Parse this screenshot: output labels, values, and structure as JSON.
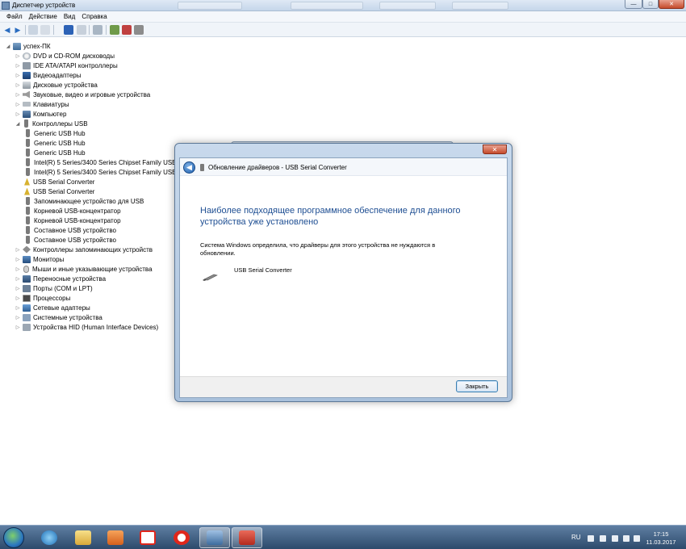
{
  "window": {
    "title": "Диспетчер устройств",
    "min_glyph": "—",
    "max_glyph": "□",
    "close_glyph": "✕"
  },
  "menu": [
    "Файл",
    "Действие",
    "Вид",
    "Справка"
  ],
  "tree": {
    "root": "успех-ПК",
    "items": [
      {
        "label": "DVD и CD-ROM дисководы",
        "icon": "ic-disc",
        "expander": "▷"
      },
      {
        "label": "IDE ATA/ATAPI контроллеры",
        "icon": "ic-ide",
        "expander": "▷"
      },
      {
        "label": "Видеоадаптеры",
        "icon": "ic-video",
        "expander": "▷"
      },
      {
        "label": "Дисковые устройства",
        "icon": "ic-disk",
        "expander": "▷"
      },
      {
        "label": "Звуковые, видео и игровые устройства",
        "icon": "ic-sound",
        "expander": "▷"
      },
      {
        "label": "Клавиатуры",
        "icon": "ic-kbd",
        "expander": "▷"
      },
      {
        "label": "Компьютер",
        "icon": "ic-pc",
        "expander": "▷"
      },
      {
        "label": "Контроллеры USB",
        "icon": "ic-usb",
        "expander": "◢"
      }
    ],
    "usb_children": [
      {
        "label": "Generic USB Hub",
        "icon": "ic-usb"
      },
      {
        "label": "Generic USB Hub",
        "icon": "ic-usb"
      },
      {
        "label": "Generic USB Hub",
        "icon": "ic-usb"
      },
      {
        "label": "Intel(R) 5 Series/3400 Series Chipset Family USB",
        "icon": "ic-usb"
      },
      {
        "label": "Intel(R) 5 Series/3400 Series Chipset Family USB",
        "icon": "ic-usb"
      },
      {
        "label": "USB Serial Converter",
        "icon": "ic-usb-warn"
      },
      {
        "label": "USB Serial Converter",
        "icon": "ic-usb-warn"
      },
      {
        "label": "Запоминающее устройство для USB",
        "icon": "ic-usb"
      },
      {
        "label": "Корневой USB-концентратор",
        "icon": "ic-usb"
      },
      {
        "label": "Корневой USB-концентратор",
        "icon": "ic-usb"
      },
      {
        "label": "Составное USB устройство",
        "icon": "ic-usb"
      },
      {
        "label": "Составное USB устройство",
        "icon": "ic-usb"
      }
    ],
    "after_items": [
      {
        "label": "Контроллеры запоминающих устройств",
        "icon": "ic-storage",
        "expander": "▷"
      },
      {
        "label": "Мониторы",
        "icon": "ic-monitor",
        "expander": "▷"
      },
      {
        "label": "Мыши и иные указывающие устройства",
        "icon": "ic-mouse",
        "expander": "▷"
      },
      {
        "label": "Переносные устройства",
        "icon": "ic-portable",
        "expander": "▷"
      },
      {
        "label": "Порты (COM и LPT)",
        "icon": "ic-port",
        "expander": "▷"
      },
      {
        "label": "Процессоры",
        "icon": "ic-cpu",
        "expander": "▷"
      },
      {
        "label": "Сетевые адаптеры",
        "icon": "ic-net",
        "expander": "▷"
      },
      {
        "label": "Системные устройства",
        "icon": "ic-system",
        "expander": "▷"
      },
      {
        "label": "Устройства HID (Human Interface Devices)",
        "icon": "ic-hid",
        "expander": "▷"
      }
    ]
  },
  "dialog": {
    "title": "Обновление драйверов - USB Serial Converter",
    "back_glyph": "◀",
    "close_glyph": "✕",
    "heading": "Наиболее подходящее программное обеспечение для данного устройства уже установлено",
    "description": "Система Windows определила, что драйверы для этого устройства не нуждаются в обновлении.",
    "device_name": "USB Serial Converter",
    "close_button": "Закрыть"
  },
  "taskbar": {
    "lang": "RU",
    "time": "17:15",
    "date": "11.03.2017"
  }
}
